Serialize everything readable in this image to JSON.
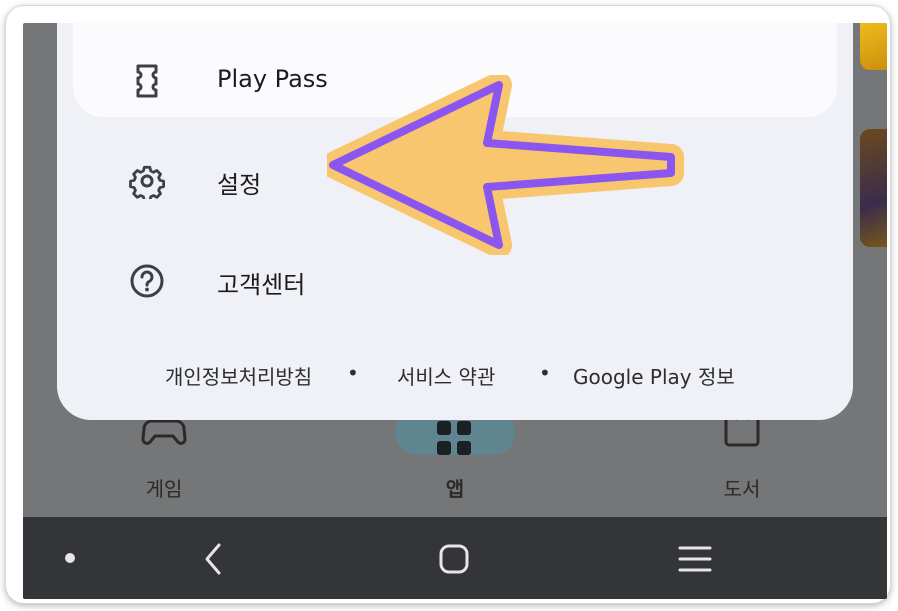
{
  "menu": {
    "play_pass": {
      "label": "Play Pass",
      "icon": "ticket-icon"
    },
    "settings": {
      "label": "설정",
      "icon": "gear-icon"
    },
    "help": {
      "label": "고객센터",
      "icon": "help-circle-icon"
    }
  },
  "footer": {
    "privacy": "개인정보처리방침",
    "separator": "•",
    "terms": "서비스 약관",
    "about": "Google Play 정보"
  },
  "bottom_nav": {
    "games": "게임",
    "apps": "앱",
    "books": "도서"
  },
  "colors": {
    "sheet": "#eff1f6",
    "arrow_fill": "#f8c66f",
    "arrow_stroke": "#8b55f0",
    "system_bar": "#333538"
  }
}
